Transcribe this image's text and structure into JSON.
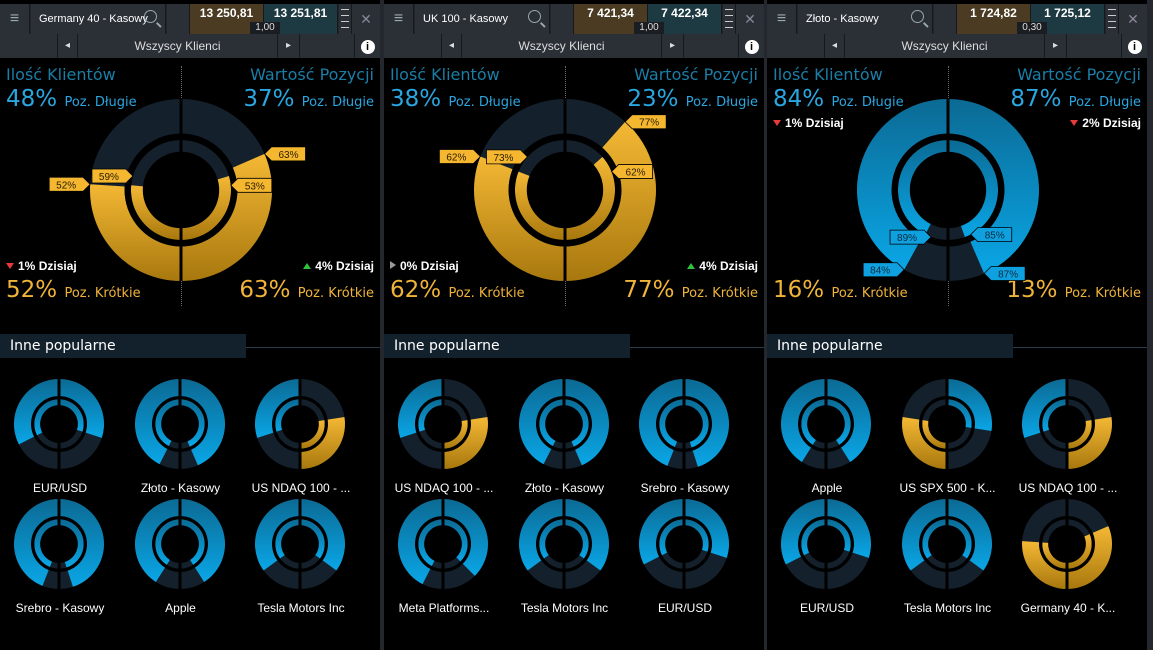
{
  "colors": {
    "long": "#1596d2",
    "short": "#eaa927",
    "empty": "#14212c",
    "accent_title": "#1b7ea8"
  },
  "labels": {
    "clients_title": "Ilość Klientów",
    "value_title": "Wartość Pozycji",
    "long_suffix": "Poz. Długie",
    "short_suffix": "Poz. Krótkie",
    "today_suffix": "Dzisiaj",
    "popular_title": "Inne popularne",
    "filter": "Wszyscy Klienci",
    "menu_icon": "≡",
    "close_icon": "✕",
    "info_icon": "i",
    "prev_icon": "◂",
    "next_icon": "▸"
  },
  "panels": [
    {
      "instrument": "Germany 40 - Kasowy",
      "sell": "13 250,81",
      "buy": "13 251,81",
      "spread": "1,00",
      "clients": {
        "long": "48%",
        "short": "52%",
        "long_value": 48,
        "inner_short": 53,
        "inner_label": "53%",
        "outer_label": "52%",
        "today": "1%",
        "today_dir": "down"
      },
      "value": {
        "long": "37%",
        "short": "63%",
        "long_value": 37,
        "inner_short": 59,
        "inner_label": "59%",
        "outer_label": "63%",
        "today": "4%",
        "today_dir": "up"
      },
      "popular": [
        {
          "name": "EUR/USD",
          "l": 65,
          "r": 60
        },
        {
          "name": "Złoto - Kasowy",
          "l": 85,
          "r": 87
        },
        {
          "name": "US NDAQ 100 - ...",
          "l": 60,
          "r": 45
        },
        {
          "name": "Srebro - Kasowy",
          "l": 88,
          "r": 90
        },
        {
          "name": "Apple",
          "l": 82,
          "r": 82
        },
        {
          "name": "Tesla Motors Inc",
          "l": 70,
          "r": 70
        }
      ]
    },
    {
      "instrument": "UK 100 - Kasowy",
      "sell": "7 421,34",
      "buy": "7 422,34",
      "spread": "1,00",
      "clients": {
        "long": "38%",
        "short": "62%",
        "long_value": 38,
        "inner_short": 62,
        "inner_label": "62%",
        "outer_label": "62%",
        "today": "0%",
        "today_dir": "flat"
      },
      "value": {
        "long": "23%",
        "short": "77%",
        "long_value": 23,
        "inner_short": 73,
        "inner_label": "73%",
        "outer_label": "77%",
        "today": "4%",
        "today_dir": "up"
      },
      "popular": [
        {
          "name": "US NDAQ 100 - ...",
          "l": 60,
          "r": 45
        },
        {
          "name": "Złoto - Kasowy",
          "l": 85,
          "r": 87
        },
        {
          "name": "Srebro - Kasowy",
          "l": 88,
          "r": 90
        },
        {
          "name": "Meta Platforms...",
          "l": 85,
          "r": 75
        },
        {
          "name": "Tesla Motors Inc",
          "l": 70,
          "r": 70
        },
        {
          "name": "EUR/USD",
          "l": 65,
          "r": 60
        }
      ]
    },
    {
      "instrument": "Złoto - Kasowy",
      "sell": "1 724,82",
      "buy": "1 725,12",
      "spread": "0,30",
      "clients": {
        "long": "84%",
        "short": "16%",
        "long_value": 84,
        "inner_short": 15,
        "inner_label": "85%",
        "outer_label": "84%",
        "today": "1%",
        "today_dir": "down"
      },
      "value": {
        "long": "87%",
        "short": "13%",
        "long_value": 87,
        "inner_short": 11,
        "inner_label": "89%",
        "outer_label": "87%",
        "today": "2%",
        "today_dir": "down"
      },
      "popular": [
        {
          "name": "Apple",
          "l": 82,
          "r": 82
        },
        {
          "name": "US SPX 500 - K...",
          "l": 45,
          "r": 55
        },
        {
          "name": "US NDAQ 100 - ...",
          "l": 60,
          "r": 45
        },
        {
          "name": "EUR/USD",
          "l": 65,
          "r": 60
        },
        {
          "name": "Tesla Motors Inc",
          "l": 70,
          "r": 70
        },
        {
          "name": "Germany 40 - K...",
          "l": 48,
          "r": 37
        }
      ]
    }
  ]
}
